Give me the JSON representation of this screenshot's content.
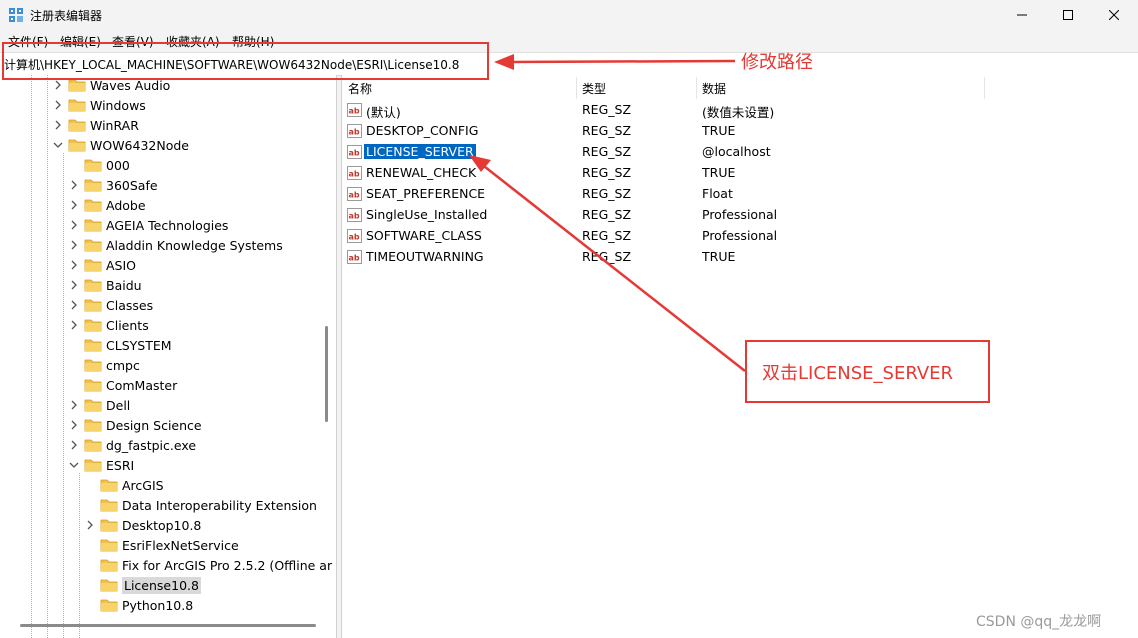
{
  "window": {
    "title": "注册表编辑器",
    "controls": {
      "minimize": "minimize-icon",
      "maximize": "maximize-icon",
      "close": "close-icon"
    }
  },
  "menu": [
    "文件(F)",
    "编辑(E)",
    "查看(V)",
    "收藏夹(A)",
    "帮助(H)"
  ],
  "address": {
    "path": "计算机\\HKEY_LOCAL_MACHINE\\SOFTWARE\\WOW6432Node\\ESRI\\License10.8"
  },
  "tree": [
    {
      "label": "Waves Audio",
      "depth": 2,
      "chevron": "right"
    },
    {
      "label": "Windows",
      "depth": 2,
      "chevron": "right"
    },
    {
      "label": "WinRAR",
      "depth": 2,
      "chevron": "right"
    },
    {
      "label": "WOW6432Node",
      "depth": 2,
      "chevron": "down"
    },
    {
      "label": "000",
      "depth": 3,
      "chevron": "none"
    },
    {
      "label": "360Safe",
      "depth": 3,
      "chevron": "right"
    },
    {
      "label": "Adobe",
      "depth": 3,
      "chevron": "right"
    },
    {
      "label": "AGEIA Technologies",
      "depth": 3,
      "chevron": "right"
    },
    {
      "label": "Aladdin Knowledge Systems",
      "depth": 3,
      "chevron": "right"
    },
    {
      "label": "ASIO",
      "depth": 3,
      "chevron": "right"
    },
    {
      "label": "Baidu",
      "depth": 3,
      "chevron": "right"
    },
    {
      "label": "Classes",
      "depth": 3,
      "chevron": "right"
    },
    {
      "label": "Clients",
      "depth": 3,
      "chevron": "right"
    },
    {
      "label": "CLSYSTEM",
      "depth": 3,
      "chevron": "none"
    },
    {
      "label": "cmpc",
      "depth": 3,
      "chevron": "none"
    },
    {
      "label": "ComMaster",
      "depth": 3,
      "chevron": "none"
    },
    {
      "label": "Dell",
      "depth": 3,
      "chevron": "right"
    },
    {
      "label": "Design Science",
      "depth": 3,
      "chevron": "right"
    },
    {
      "label": "dg_fastpic.exe",
      "depth": 3,
      "chevron": "right"
    },
    {
      "label": "ESRI",
      "depth": 3,
      "chevron": "down"
    },
    {
      "label": "ArcGIS",
      "depth": 4,
      "chevron": "none"
    },
    {
      "label": "Data Interoperability Extension",
      "depth": 4,
      "chevron": "none"
    },
    {
      "label": "Desktop10.8",
      "depth": 4,
      "chevron": "right"
    },
    {
      "label": "EsriFlexNetService",
      "depth": 4,
      "chevron": "none"
    },
    {
      "label": "Fix for ArcGIS Pro 2.5.2 (Offline ar",
      "depth": 4,
      "chevron": "none"
    },
    {
      "label": "License10.8",
      "depth": 4,
      "chevron": "none",
      "selected": true
    },
    {
      "label": "Python10.8",
      "depth": 4,
      "chevron": "none"
    }
  ],
  "values": {
    "headers": {
      "name": "名称",
      "type": "类型",
      "data": "数据"
    },
    "rows": [
      {
        "name": "(默认)",
        "type": "REG_SZ",
        "data": "(数值未设置)"
      },
      {
        "name": "DESKTOP_CONFIG",
        "type": "REG_SZ",
        "data": "TRUE"
      },
      {
        "name": "LICENSE_SERVER",
        "type": "REG_SZ",
        "data": "@localhost",
        "selected": true
      },
      {
        "name": "RENEWAL_CHECK",
        "type": "REG_SZ",
        "data": "TRUE"
      },
      {
        "name": "SEAT_PREFERENCE",
        "type": "REG_SZ",
        "data": "Float"
      },
      {
        "name": "SingleUse_Installed",
        "type": "REG_SZ",
        "data": "Professional"
      },
      {
        "name": "SOFTWARE_CLASS",
        "type": "REG_SZ",
        "data": "Professional"
      },
      {
        "name": "TIMEOUTWARNING",
        "type": "REG_SZ",
        "data": "TRUE"
      }
    ]
  },
  "annotations": {
    "path_label": "修改路径",
    "double_click_label": "双击LICENSE_SERVER",
    "color": "#e53935"
  },
  "watermark": "CSDN @qq_龙龙啊",
  "colors": {
    "selection": "#0067c0",
    "folder": "#f2c14e",
    "annotation": "#e53935"
  }
}
